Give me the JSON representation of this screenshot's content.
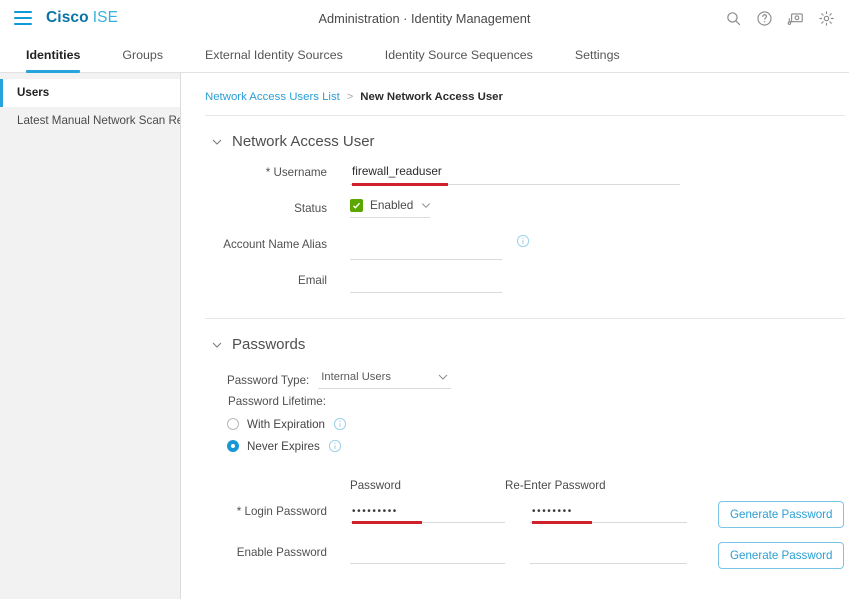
{
  "header": {
    "menu_icon": "hamburger-menu-icon",
    "brand_primary": "Cisco",
    "brand_secondary": "ISE",
    "title": "Administration · Identity Management",
    "icons": [
      {
        "name": "search-icon",
        "label": "Search"
      },
      {
        "name": "help-icon",
        "label": "Help"
      },
      {
        "name": "feedback-icon",
        "label": "Feedback"
      },
      {
        "name": "gear-icon",
        "label": "Settings"
      }
    ]
  },
  "tabs": [
    {
      "label": "Identities",
      "active": true
    },
    {
      "label": "Groups",
      "active": false
    },
    {
      "label": "External Identity Sources",
      "active": false
    },
    {
      "label": "Identity Source Sequences",
      "active": false
    },
    {
      "label": "Settings",
      "active": false
    }
  ],
  "sidebar": {
    "items": [
      {
        "label": "Users",
        "active": true
      },
      {
        "label": "Latest Manual Network Scan Res...",
        "active": false
      }
    ]
  },
  "breadcrumb": {
    "parent": "Network Access Users List",
    "separator": ">",
    "current": "New Network Access User"
  },
  "sections": {
    "user": {
      "title": "Network Access User",
      "collapse_icon": "chevron-down-icon",
      "fields": {
        "username": {
          "label": "* Username",
          "value": "firewall_readuser",
          "placeholder": "",
          "highlighted": true
        },
        "status": {
          "label": "Status",
          "value": "Enabled",
          "checkbox_icon": "check-icon",
          "chevron_icon": "chevron-down-icon",
          "checkbox_color": "#5aa700"
        },
        "account_name_alias": {
          "label": "Account Name Alias",
          "value": "",
          "placeholder": "",
          "info_icon": "info-icon"
        },
        "email": {
          "label": "Email",
          "value": "",
          "placeholder": ""
        }
      }
    },
    "passwords": {
      "title": "Passwords",
      "collapse_icon": "chevron-down-icon",
      "password_type": {
        "label": "Password Type:",
        "value": "Internal Users",
        "chevron_icon": "chevron-down-icon"
      },
      "lifetime": {
        "label": "Password Lifetime:",
        "options": [
          {
            "label": "With Expiration",
            "selected": false,
            "info_icon": "info-icon"
          },
          {
            "label": "Never Expires",
            "selected": true,
            "info_icon": "info-icon"
          }
        ]
      },
      "column_headers": {
        "password": "Password",
        "reenter": "Re-Enter Password"
      },
      "rows": [
        {
          "label": "* Login Password",
          "password_value": "•••••••••",
          "reenter_value": "••••••••",
          "button_label": "Generate Password",
          "info_icon": "info-icon",
          "highlighted": true
        },
        {
          "label": "Enable Password",
          "password_value": "",
          "reenter_value": "",
          "button_label": "Generate Password",
          "info_icon": "info-icon",
          "highlighted": false
        }
      ]
    }
  },
  "colors": {
    "accent": "#27a3dd",
    "brand_dark": "#0a74a8",
    "brand_light": "#35b0e0",
    "link": "#2b9fd4",
    "status_green": "#5aa700",
    "highlight_red": "#d0202c",
    "sidebar_bg": "#f2f2f2"
  }
}
